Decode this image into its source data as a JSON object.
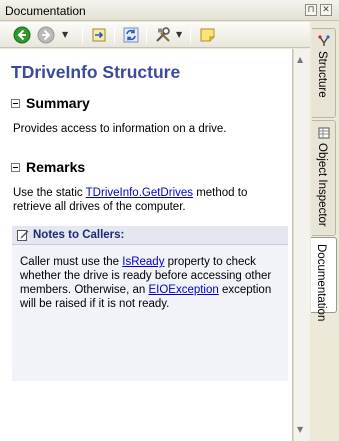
{
  "window": {
    "title": "Documentation"
  },
  "titlebar_buttons": {
    "pin": "⊓",
    "close": "✕"
  },
  "toolbar": {
    "back_icon": "back-arrow-icon",
    "forward_icon": "forward-arrow-icon",
    "history_icon": "history-dropdown-icon",
    "sync_icon": "sync-to-code-icon",
    "refresh_icon": "refresh-icon",
    "tools_icon": "tools-icon",
    "note_icon": "note-icon",
    "colors": {
      "back": "#2e9a2a",
      "disabled": "#a6a6a6"
    }
  },
  "doc": {
    "title": "TDriveInfo Structure",
    "summary": {
      "heading": "Summary",
      "text": "Provides access to information on a drive."
    },
    "remarks": {
      "heading": "Remarks",
      "pre": "Use the static ",
      "link": "TDriveInfo.GetDrives",
      "post": " method to retrieve all drives of the computer."
    },
    "note": {
      "title": "Notes to Callers:",
      "t1": "Caller must use the ",
      "link1": "IsReady",
      "t2": " property to check whether the drive is ready before accessing other members. Otherwise, an ",
      "link2": "EIOException",
      "t3": " exception will be raised if it is not ready."
    },
    "colors": {
      "title": "#3b4b9b",
      "link": "#0000cc",
      "note_bg": "#f1f3f8"
    }
  },
  "side_tabs": [
    {
      "label": "Structure",
      "icon": "structure-icon",
      "active": false
    },
    {
      "label": "Object Inspector",
      "icon": "object-inspector-icon",
      "active": false
    },
    {
      "label": "Documentation",
      "icon": "",
      "active": true
    }
  ]
}
